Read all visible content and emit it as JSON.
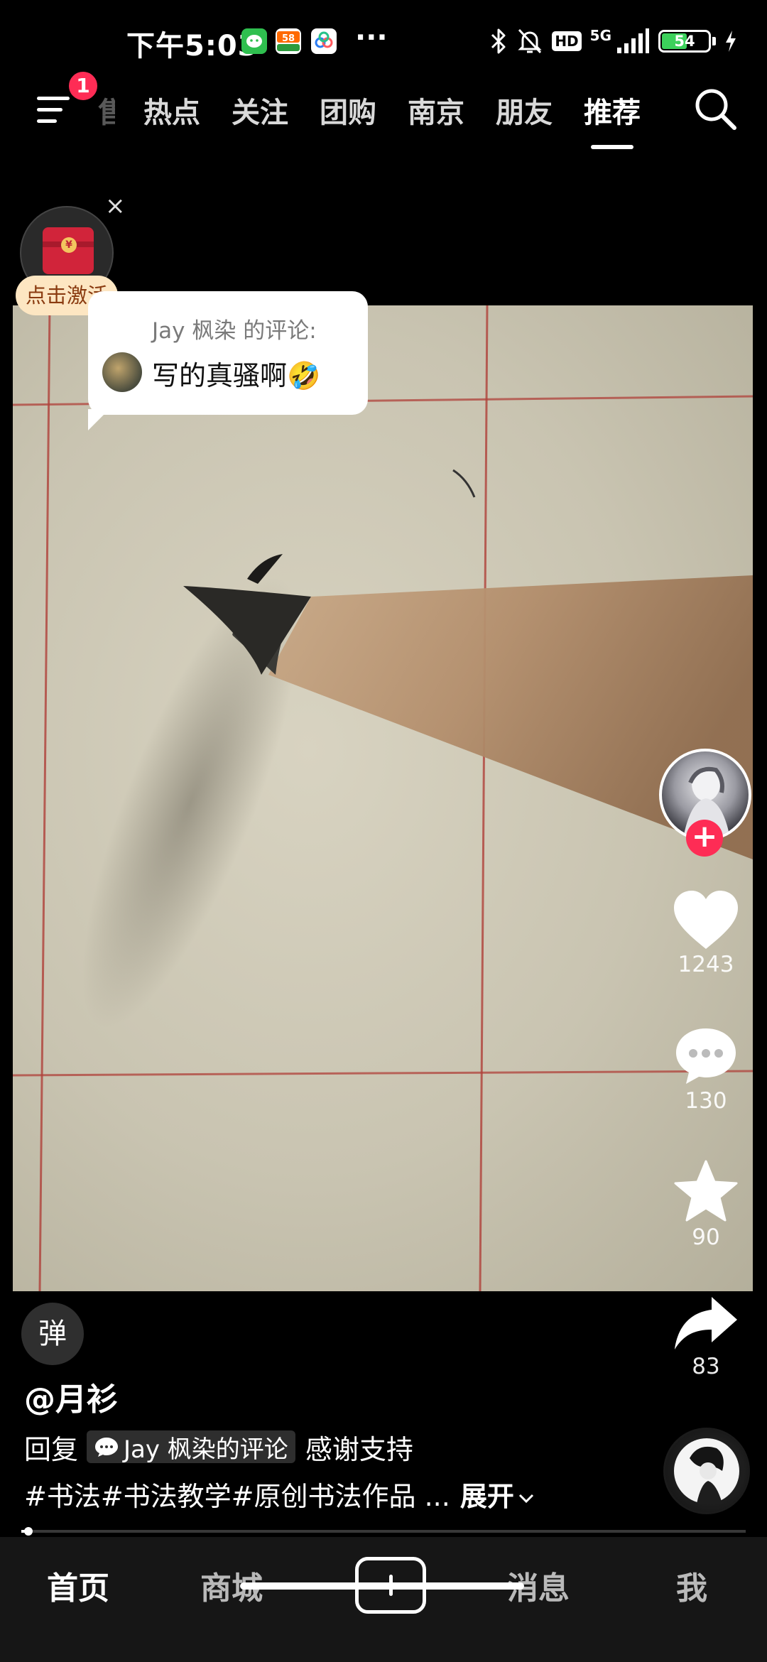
{
  "status_bar": {
    "time": "下午5:03",
    "app_icons": [
      "wechat-icon",
      "58-app-icon",
      "baidu-netdisk-icon"
    ],
    "more": "···",
    "hd": "HD",
    "network": "5G",
    "battery": "54",
    "battery_level_percent": 54
  },
  "top_nav": {
    "menu_badge": "1",
    "tabs": [
      {
        "label": "售",
        "state": "faded"
      },
      {
        "label": "热点"
      },
      {
        "label": "关注"
      },
      {
        "label": "团购"
      },
      {
        "label": "南京"
      },
      {
        "label": "朋友"
      },
      {
        "label": "推荐",
        "state": "active"
      }
    ]
  },
  "red_packet": {
    "coin": "¥",
    "label": "点击激活",
    "close": "×"
  },
  "comment_bubble": {
    "author_line": "Jay 枫染 的评论:",
    "text": "写的真骚啊🤣"
  },
  "right_rail": {
    "follow": "+",
    "likes": "1243",
    "comments": "130",
    "favorites": "90",
    "shares": "83"
  },
  "bottom_info": {
    "danmu": "弹",
    "author": "@月衫",
    "reply_prefix": "回复",
    "reply_chip": "Jay 枫染的评论",
    "reply_text": "感谢支持",
    "hashtags": "#书法#书法教学#原创书法作品 ...",
    "expand": "展开",
    "progress_fraction": 0.01
  },
  "tabbar": {
    "home": "首页",
    "mall": "商城",
    "messages": "消息",
    "me": "我"
  },
  "colors": {
    "accent": "#fe2c55",
    "background": "#000000",
    "tabbar": "#161616"
  }
}
